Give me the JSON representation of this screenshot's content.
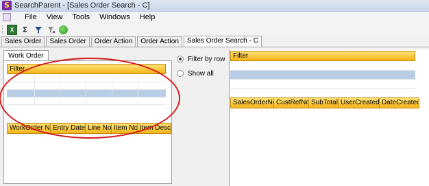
{
  "window": {
    "title": "SearchParent - [Sales Order Search - C]",
    "icon": "app-s-icon"
  },
  "menu": {
    "items": [
      "File",
      "View",
      "Tools",
      "Windows",
      "Help"
    ]
  },
  "toolbar": {
    "icons": [
      "excel-export-icon",
      "sigma-icon",
      "filter-icon",
      "clear-filter-icon",
      "refresh-icon"
    ]
  },
  "tabs": [
    "Sales Order",
    "Sales Order",
    "Order Action",
    "Order Action",
    "Sales Order Search - C"
  ],
  "left": {
    "inner_tab": "Work Order",
    "filter_label": "Filter",
    "columns": [
      "WorkOrder No",
      "Entry Date",
      "Line No",
      "Item No",
      "Item Descri"
    ]
  },
  "options": {
    "filter_by_row": "Filter by row",
    "show_all": "Show all",
    "selected": "filter_by_row"
  },
  "right": {
    "filter_label": "Filter",
    "columns": [
      "SalesOrderNo",
      "CustRefNo",
      "SubTotal",
      "UserCreated",
      "DateCreated"
    ]
  },
  "colors": {
    "header_gradient_top": "#ffe27a",
    "header_gradient_bottom": "#f5b417",
    "selection": "#b8cde6",
    "annotation": "#d21a1a"
  }
}
